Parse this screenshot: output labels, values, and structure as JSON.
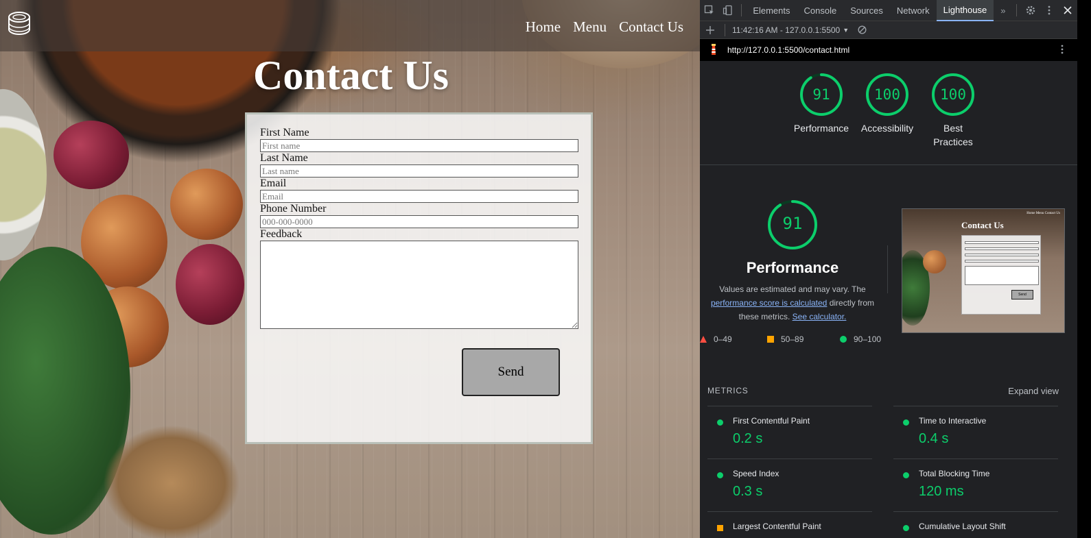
{
  "site": {
    "nav": [
      "Home",
      "Menu",
      "Contact Us"
    ],
    "page_title": "Contact Us",
    "form": {
      "first_name_label": "First Name",
      "first_name_placeholder": "First name",
      "last_name_label": "Last Name",
      "last_name_placeholder": "Last name",
      "email_label": "Email",
      "email_placeholder": "Email",
      "phone_label": "Phone Number",
      "phone_placeholder": "000-000-0000",
      "feedback_label": "Feedback",
      "send_label": "Send"
    }
  },
  "devtools": {
    "tabs": [
      "Elements",
      "Console",
      "Sources",
      "Network",
      "Lighthouse"
    ],
    "active_tab": "Lighthouse",
    "overflow_label": "»",
    "report_selector": "11:42:16 AM - 127.0.0.1:5500",
    "url": "http://127.0.0.1:5500/contact.html",
    "scores": [
      {
        "label": "Performance",
        "value": "91",
        "score": 0.91
      },
      {
        "label": "Accessibility",
        "value": "100",
        "score": 1.0
      },
      {
        "label": "Best Practices",
        "value": "100",
        "score": 1.0
      }
    ],
    "performance": {
      "value": "91",
      "score": 0.91,
      "title": "Performance",
      "desc_1": "Values are estimated and may vary. The",
      "link_1": "performance score is calculated",
      "desc_2": "directly from these metrics.",
      "link_2": "See calculator."
    },
    "legend": [
      "0–49",
      "50–89",
      "90–100"
    ],
    "thumbnail": {
      "title": "Contact Us",
      "nav": "Home  Menu  Contact Us",
      "send": "Send"
    },
    "metrics_title": "METRICS",
    "expand_view": "Expand view",
    "metrics": [
      {
        "name": "First Contentful Paint",
        "value": "0.2 s",
        "status": "good"
      },
      {
        "name": "Time to Interactive",
        "value": "0.4 s",
        "status": "good"
      },
      {
        "name": "Speed Index",
        "value": "0.3 s",
        "status": "good"
      },
      {
        "name": "Total Blocking Time",
        "value": "120 ms",
        "status": "good"
      },
      {
        "name": "Largest Contentful Paint",
        "value": "",
        "status": "average"
      },
      {
        "name": "Cumulative Layout Shift",
        "value": "",
        "status": "good"
      }
    ],
    "colors": {
      "good": "#0cce6b",
      "average": "#ffa400",
      "fail": "#ff4e42",
      "link": "#8ab4f8"
    }
  }
}
